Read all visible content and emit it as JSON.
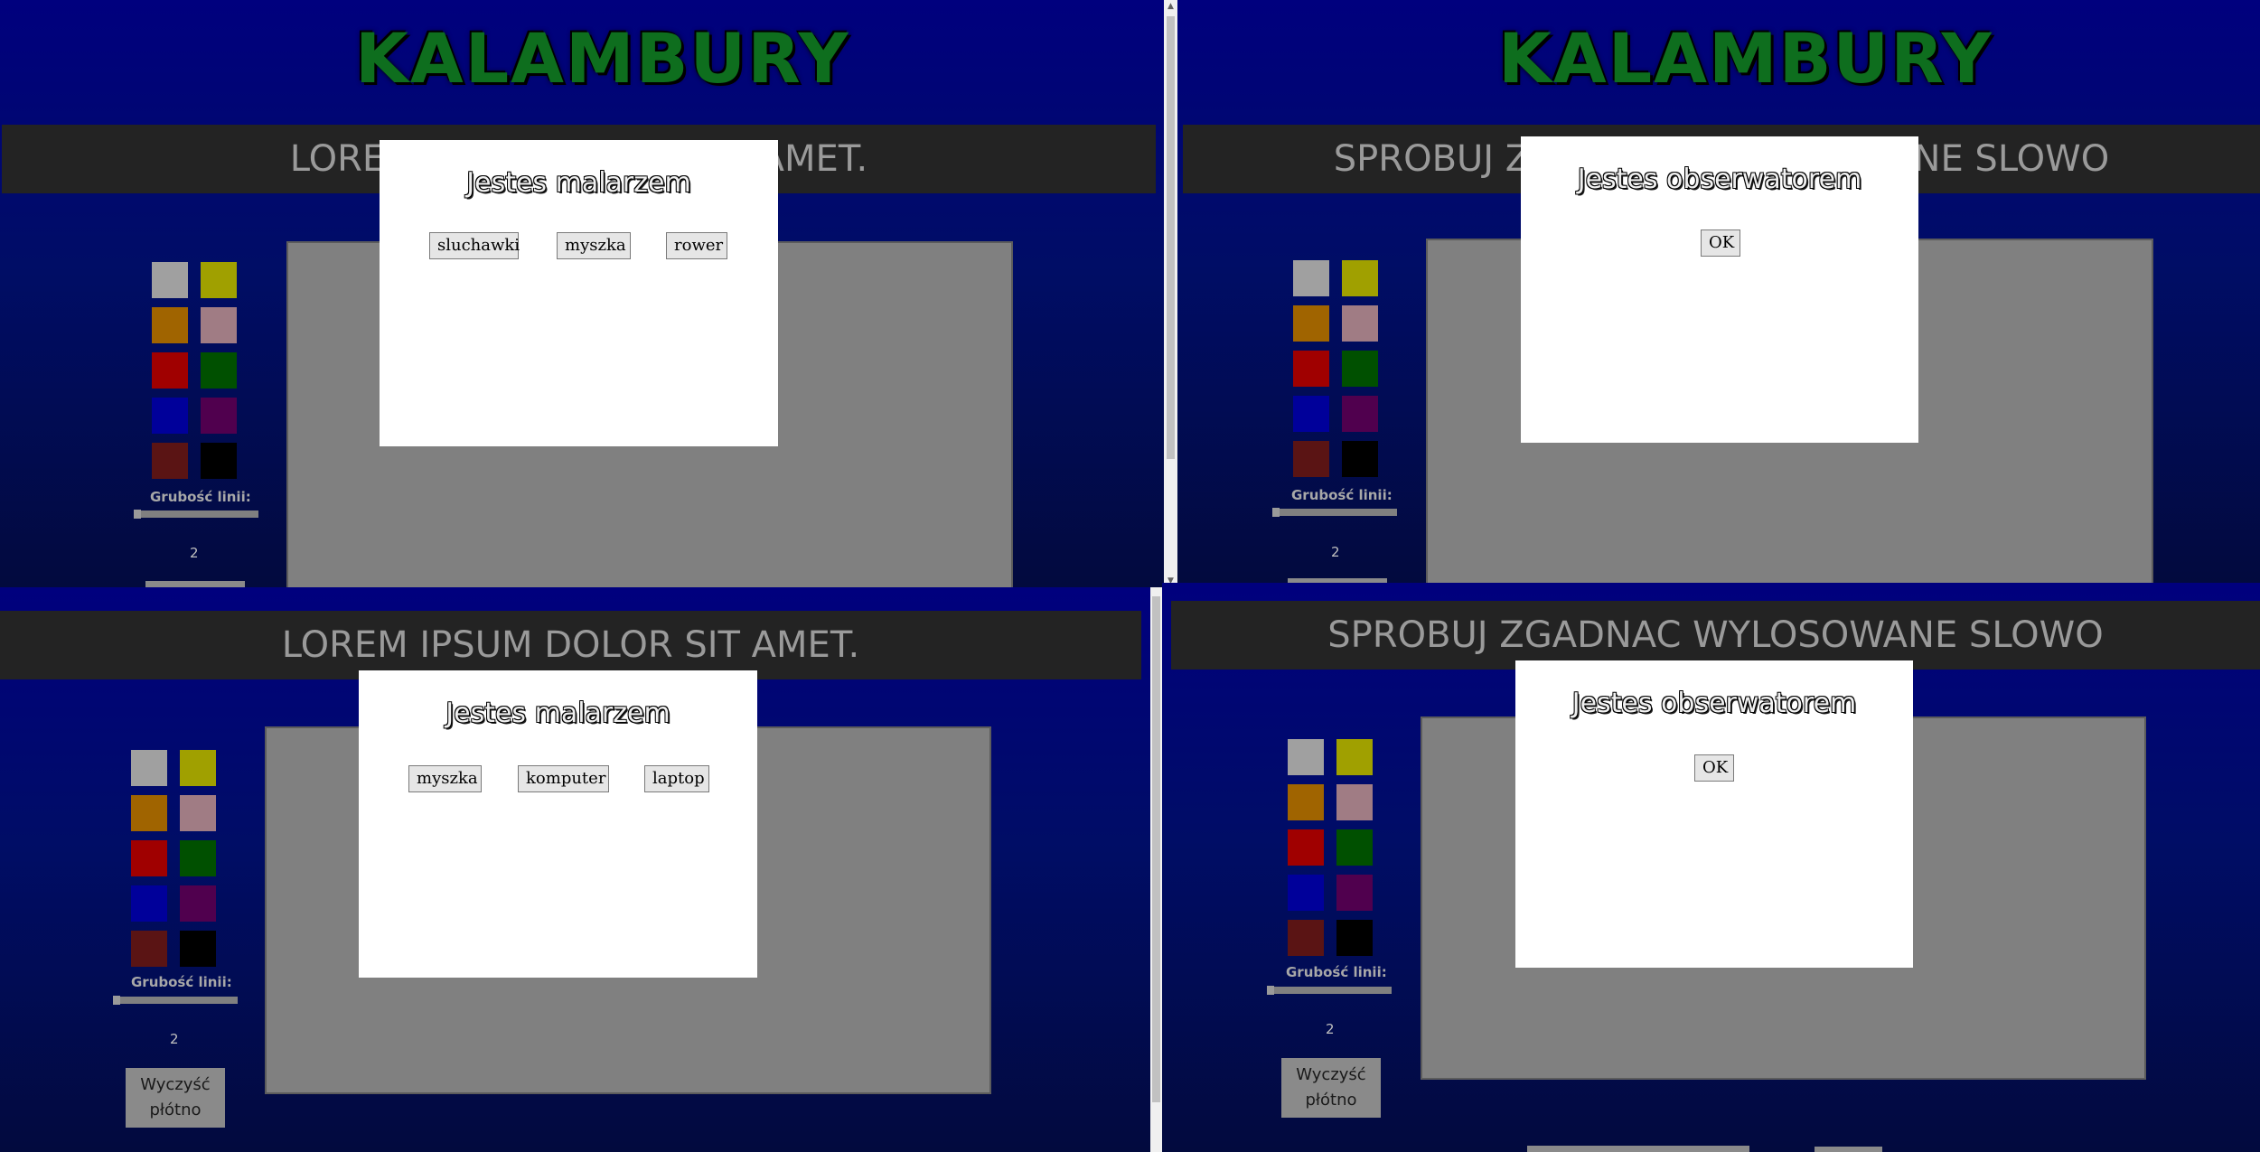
{
  "game_title": "KALAMBURY",
  "banner_drawer": "LOREM IPSUM DOLOR SIT AMET.",
  "banner_observer": "SPROBUJ ZGADNAC WYLOSOWANE SLOWO",
  "thickness_label": "Grubość linii:",
  "thickness_value": "2",
  "clear_button": "Wyczyść płótno",
  "palette": [
    "#a0a0a0",
    "#a0a000",
    "#a06400",
    "#a07c84",
    "#a00000",
    "#005000",
    "#00009a",
    "#50004e",
    "#5a1414",
    "#000000"
  ],
  "panels": {
    "top_left": {
      "modal_title": "Jestes malarzem",
      "words": [
        "sluchawki",
        "myszka",
        "rower"
      ]
    },
    "top_right": {
      "modal_title": "Jestes obserwatorem",
      "ok": "OK"
    },
    "bottom_left": {
      "modal_title": "Jestes malarzem",
      "words": [
        "myszka",
        "komputer",
        "laptop"
      ]
    },
    "bottom_right": {
      "modal_title": "Jestes obserwatorem",
      "ok": "OK"
    }
  }
}
